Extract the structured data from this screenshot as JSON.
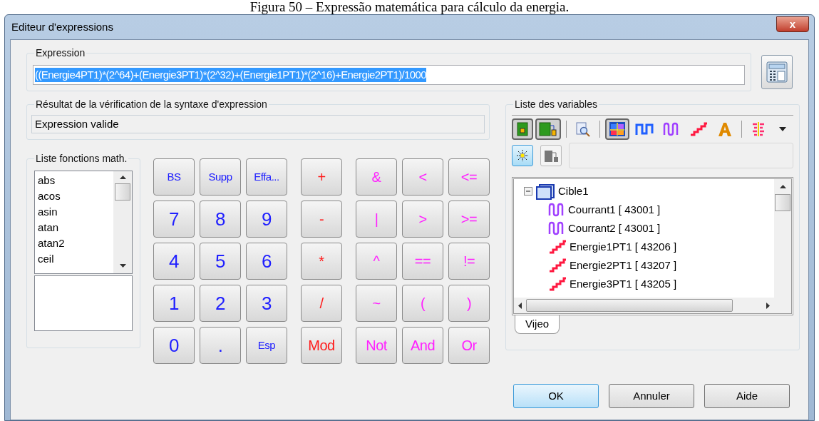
{
  "caption": "Figura 50 – Expressão matemática para cálculo da energia.",
  "window": {
    "title": "Editeur d'expressions",
    "close": "x"
  },
  "expression": {
    "label": "Expression",
    "value": "((Energie4PT1)*(2^64)+(Energie3PT1)*(2^32)+(Energie1PT1)*(2^16)+Energie2PT1)/1000",
    "selected": true
  },
  "syntax": {
    "label": "Résultat de la vérification de la syntaxe d'expression",
    "value": "Expression valide"
  },
  "functions": {
    "label": "Liste fonctions math.",
    "items": [
      "abs",
      "acos",
      "asin",
      "atan",
      "atan2",
      "ceil"
    ]
  },
  "keypad": [
    [
      {
        "label": "BS",
        "kind": "edit"
      },
      {
        "label": "Supp",
        "kind": "edit"
      },
      {
        "label": "Effa...",
        "kind": "edit"
      },
      {
        "label": "+",
        "kind": "arith"
      },
      {
        "label": "&",
        "kind": "logic"
      },
      {
        "label": "<",
        "kind": "logic"
      },
      {
        "label": "<=",
        "kind": "logic"
      }
    ],
    [
      {
        "label": "7",
        "kind": "digit"
      },
      {
        "label": "8",
        "kind": "digit"
      },
      {
        "label": "9",
        "kind": "digit"
      },
      {
        "label": "-",
        "kind": "arith"
      },
      {
        "label": "|",
        "kind": "logic"
      },
      {
        "label": ">",
        "kind": "logic"
      },
      {
        "label": ">=",
        "kind": "logic"
      }
    ],
    [
      {
        "label": "4",
        "kind": "digit"
      },
      {
        "label": "5",
        "kind": "digit"
      },
      {
        "label": "6",
        "kind": "digit"
      },
      {
        "label": "*",
        "kind": "arith"
      },
      {
        "label": "^",
        "kind": "logic"
      },
      {
        "label": "==",
        "kind": "logic"
      },
      {
        "label": "!=",
        "kind": "logic"
      }
    ],
    [
      {
        "label": "1",
        "kind": "digit"
      },
      {
        "label": "2",
        "kind": "digit"
      },
      {
        "label": "3",
        "kind": "digit"
      },
      {
        "label": "/",
        "kind": "arith"
      },
      {
        "label": "~",
        "kind": "logic"
      },
      {
        "label": "(",
        "kind": "logic"
      },
      {
        "label": ")",
        "kind": "logic"
      }
    ],
    [
      {
        "label": "0",
        "kind": "digit"
      },
      {
        "label": ".",
        "kind": "digit"
      },
      {
        "label": "Esp",
        "kind": "edit"
      },
      {
        "label": "Mod",
        "kind": "arith"
      },
      {
        "label": "Not",
        "kind": "logic"
      },
      {
        "label": "And",
        "kind": "logic"
      },
      {
        "label": "Or",
        "kind": "logic"
      }
    ]
  ],
  "variables": {
    "label": "Liste des variables",
    "toolbar": [
      {
        "kind": "station",
        "pressed": true
      },
      {
        "kind": "network",
        "pressed": true
      },
      {
        "kind": "sep"
      },
      {
        "kind": "preview",
        "pressed": false
      },
      {
        "kind": "sep"
      },
      {
        "kind": "grid",
        "pressed": true
      },
      {
        "kind": "digital",
        "pressed": false
      },
      {
        "kind": "analog",
        "pressed": false
      },
      {
        "kind": "counter",
        "pressed": false
      },
      {
        "kind": "text",
        "pressed": false
      },
      {
        "kind": "sep"
      },
      {
        "kind": "sort",
        "pressed": false
      },
      {
        "kind": "dropdown",
        "pressed": false
      }
    ],
    "toolbar2": [
      {
        "kind": "spark",
        "pressed": true
      },
      {
        "kind": "device",
        "pressed": false
      }
    ],
    "tree": [
      {
        "label": "Cible1",
        "expanded": true,
        "children": [
          {
            "label": "Courrant1 [ 43001 ]",
            "kind": "analog"
          },
          {
            "label": "Courrant2 [ 43001 ]",
            "kind": "analog"
          },
          {
            "label": "Energie1PT1 [ 43206 ]",
            "kind": "counter"
          },
          {
            "label": "Energie2PT1 [ 43207 ]",
            "kind": "counter"
          },
          {
            "label": "Energie3PT1 [ 43205 ]",
            "kind": "counter"
          }
        ]
      }
    ],
    "tabs": [
      {
        "label": "Vijeo",
        "selected": true
      }
    ]
  },
  "buttons": [
    {
      "label": "OK",
      "default": true
    },
    {
      "label": "Annuler",
      "default": false
    },
    {
      "label": "Aide",
      "default": false
    }
  ]
}
